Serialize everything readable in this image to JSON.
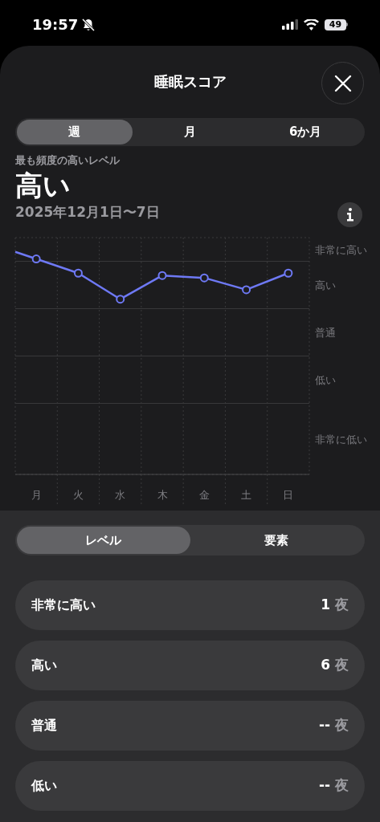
{
  "status_bar": {
    "time": "19:57",
    "battery": "49"
  },
  "title": "睡眠スコア",
  "period_tabs": [
    {
      "label": "週",
      "selected": true
    },
    {
      "label": "月",
      "selected": false
    },
    {
      "label": "6か月",
      "selected": false
    }
  ],
  "summary": {
    "caption": "最も頻度の高いレベル",
    "value": "高い",
    "date_range": "2025年12月1日〜7日"
  },
  "chart": {
    "day_labels": [
      "月",
      "火",
      "水",
      "木",
      "金",
      "土",
      "日"
    ],
    "level_labels": [
      "非常に高い",
      "高い",
      "普通",
      "低い",
      "非常に低い"
    ]
  },
  "view_tabs": [
    {
      "label": "レベル",
      "selected": true
    },
    {
      "label": "要素",
      "selected": false
    }
  ],
  "level_rows": [
    {
      "label": "非常に高い",
      "count": "1",
      "unit": "夜"
    },
    {
      "label": "高い",
      "count": "6",
      "unit": "夜"
    },
    {
      "label": "普通",
      "count": "--",
      "unit": "夜"
    },
    {
      "label": "低い",
      "count": "--",
      "unit": "夜"
    }
  ]
}
